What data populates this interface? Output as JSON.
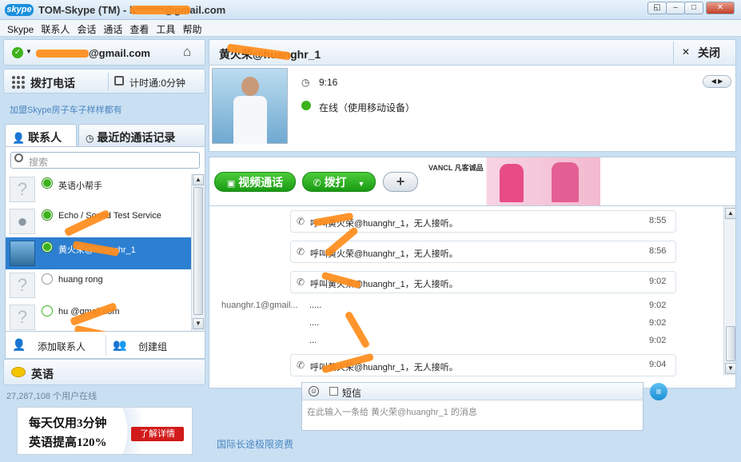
{
  "window": {
    "logo": "skype",
    "title": "TOM-Skype (TM) - h*******@gmail.com",
    "restore": "◱",
    "minimize": "–",
    "maximize": "□",
    "close": "✕"
  },
  "menu": [
    "Skype",
    "联系人",
    "会话",
    "通话",
    "查看",
    "工具",
    "帮助"
  ],
  "account": {
    "email": "@gmail.com",
    "status_icon": "online-check-icon",
    "home_icon": "home-icon"
  },
  "callbar": {
    "dial_label": "拨打电话",
    "timer_label": "计时通:0分钟"
  },
  "promo_link": "加盟Skype房子车子样样都有",
  "tabs": {
    "contacts": "联系人",
    "recent": "最近的通话记录"
  },
  "search": {
    "placeholder": "搜索"
  },
  "contacts": [
    {
      "name": "英语小帮手",
      "status": "online"
    },
    {
      "name": "Echo / Sound Test Service",
      "status": "online"
    },
    {
      "name": "黄火荣@huanghr_1",
      "status": "online",
      "selected": true
    },
    {
      "name": "huang   rong",
      "status": "unknown"
    },
    {
      "name": "hu          @gmail.com",
      "status": "offline"
    }
  ],
  "actions": {
    "add_contact": "添加联系人",
    "create_group": "创建组"
  },
  "language": {
    "label": "英语"
  },
  "online_count": "27,287,108 个用户在线",
  "ad_left": {
    "line1": "每天仅用3分钟",
    "line2": "英语提高120%",
    "button": "了解详情"
  },
  "chat": {
    "contact_name": "黄火荣@huanghr_1",
    "close_label": "关闭",
    "local_time": "9:16",
    "status_text": "在线（使用移动设备）"
  },
  "toolbar": {
    "video_call": "视频通话",
    "call": "拨打",
    "add": "+",
    "ad_brand": "VANCL 凡客诚品"
  },
  "history": [
    {
      "type": "call",
      "text": "呼叫黄火荣@huanghr_1，无人接听。",
      "time": "8:55"
    },
    {
      "type": "call",
      "text": "呼叫黄火荣@huanghr_1，无人接听。",
      "time": "8:56"
    },
    {
      "type": "call",
      "text": "呼叫黄火荣@huanghr_1，无人接听。",
      "time": "9:02"
    },
    {
      "type": "msg",
      "sender": "huanghr.1@gmail...",
      "text": ".....",
      "time": "9:02"
    },
    {
      "type": "msg",
      "sender": "",
      "text": "....",
      "time": "9:02"
    },
    {
      "type": "msg",
      "sender": "",
      "text": "...",
      "time": "9:02"
    },
    {
      "type": "call",
      "text": "呼叫黄火荣@huanghr_1，无人接听。",
      "time": "9:04"
    }
  ],
  "input": {
    "sms_label": "短信",
    "placeholder": "在此输入一条给 黄火荣@huanghr_1 的消息"
  },
  "footer_link": "国际长途极限资费"
}
